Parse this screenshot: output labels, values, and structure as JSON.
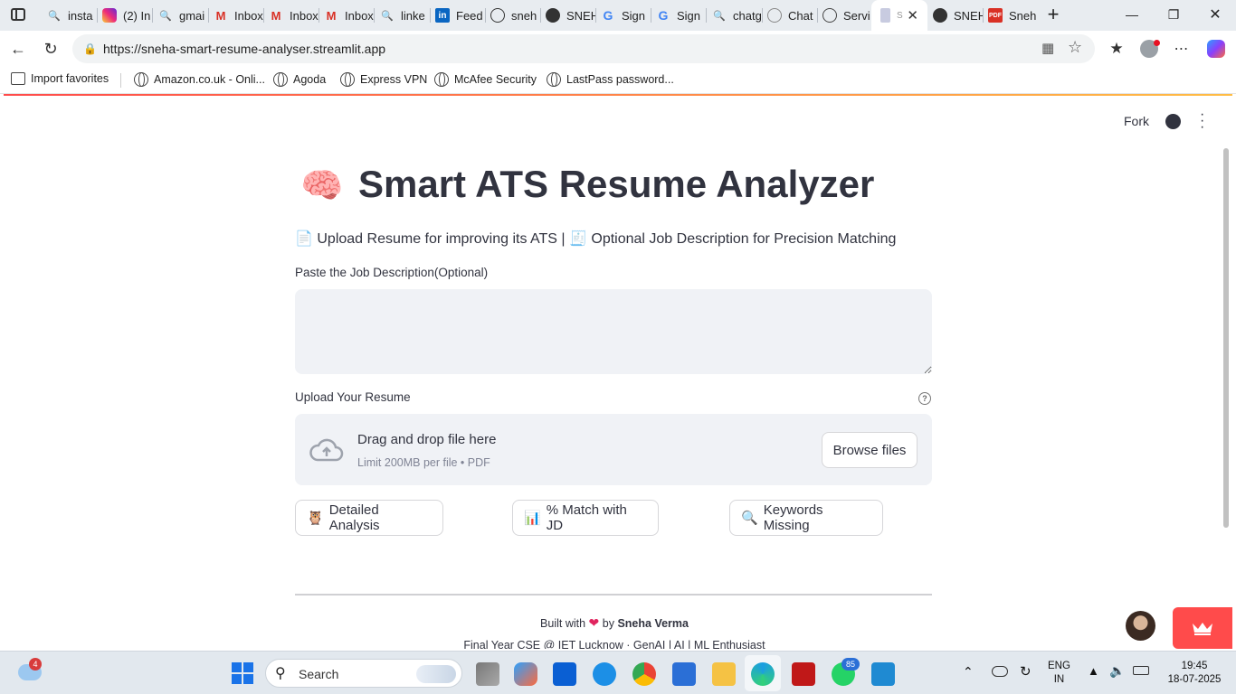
{
  "browser": {
    "tabs": [
      {
        "label": "insta",
        "icon": "search-icon"
      },
      {
        "label": "(2) In",
        "icon": "instagram-icon"
      },
      {
        "label": "gmai",
        "icon": "search-icon"
      },
      {
        "label": "Inbox",
        "icon": "gmail-icon"
      },
      {
        "label": "Inbox",
        "icon": "gmail-icon"
      },
      {
        "label": "Inbox",
        "icon": "gmail-icon"
      },
      {
        "label": "linke",
        "icon": "search-icon"
      },
      {
        "label": "Feed",
        "icon": "linkedin-icon"
      },
      {
        "label": "sneh",
        "icon": "globe-icon"
      },
      {
        "label": "SNEH",
        "icon": "github-icon"
      },
      {
        "label": "Sign",
        "icon": "google-icon"
      },
      {
        "label": "Sign",
        "icon": "google-icon"
      },
      {
        "label": "chatg",
        "icon": "search-icon"
      },
      {
        "label": "Chat",
        "icon": "chatgpt-icon"
      },
      {
        "label": "Servi",
        "icon": "chatgpt-icon"
      },
      {
        "label": "S",
        "icon": "document-icon"
      },
      {
        "label": "SNEH",
        "icon": "github-icon"
      },
      {
        "label": "Sneh",
        "icon": "pdf-icon"
      }
    ],
    "url": "https://sneha-smart-resume-analyser.streamlit.app",
    "bookmarks": [
      "Import favorites",
      "Amazon.co.uk - Onli...",
      "Agoda",
      "Express VPN",
      "McAfee Security",
      "LastPass password..."
    ]
  },
  "app": {
    "header": {
      "fork_label": "Fork"
    },
    "title_emoji": "🧠",
    "title": "Smart ATS Resume Analyzer",
    "subtitle": "📄 Upload Resume for improving its ATS | 🧾 Optional Job Description for Precision Matching",
    "jd_label": "Paste the Job Description(Optional)",
    "jd_value": "",
    "upload_label": "Upload Your Resume",
    "dropzone": {
      "title": "Drag and drop file here",
      "hint": "Limit 200MB per file • PDF",
      "browse_label": "Browse files"
    },
    "buttons": [
      {
        "emoji": "🦉",
        "label": "Detailed Analysis"
      },
      {
        "emoji": "📊",
        "label": "% Match with JD"
      },
      {
        "emoji": "🔍",
        "label": "Keywords Missing"
      }
    ],
    "footer": {
      "built_with": "Built with",
      "heart": "❤",
      "by": "by",
      "author": "Sneha Verma",
      "line2": "Final Year CSE @ IET Lucknow · GenAI | AI | ML Enthusiast"
    }
  },
  "taskbar": {
    "weather_badge": "4",
    "search_placeholder": "Search",
    "whatsapp_badge": "85",
    "lang_top": "ENG",
    "lang_bottom": "IN",
    "time": "19:45",
    "date": "18-07-2025"
  },
  "colors": {
    "accent_red": "#ff4b4b",
    "text": "#31333f",
    "input_bg": "#f0f2f6"
  }
}
